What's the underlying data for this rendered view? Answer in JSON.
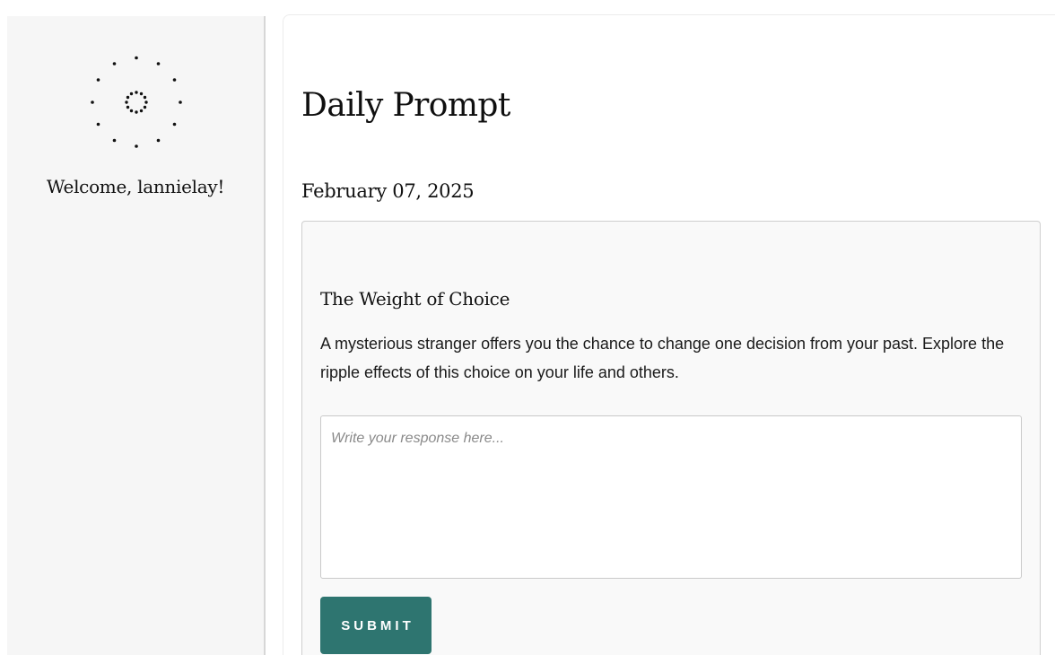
{
  "sidebar": {
    "logo_icon": "dotted-ring-logo-icon",
    "welcome_text": "Welcome, lannielay!"
  },
  "main": {
    "title": "Daily Prompt",
    "date": "February 07, 2025",
    "prompt": {
      "title": "The Weight of Choice",
      "body": "A mysterious stranger offers you the chance to change one decision from your past. Explore the ripple effects of this choice on your life and others.",
      "response_value": "",
      "response_placeholder": "Write your response here...",
      "submit_label": "SUBMIT"
    }
  },
  "colors": {
    "accent": "#2e7570",
    "sidebar_bg": "#f6f6f6",
    "card_bg": "#f9f9f9"
  }
}
